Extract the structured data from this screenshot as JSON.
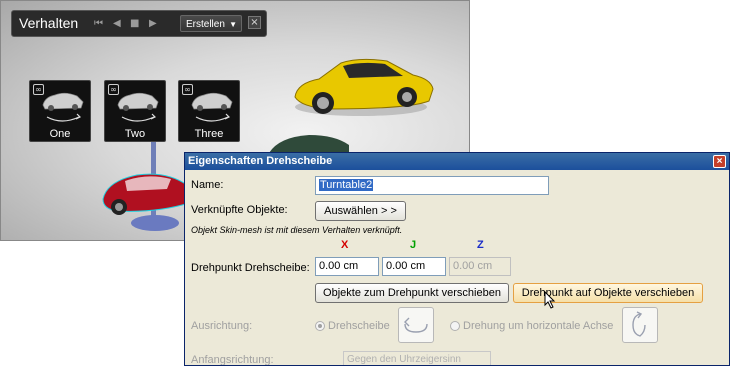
{
  "viewport": {
    "toolbar": {
      "title": "Verhalten",
      "create_button": "Erstellen",
      "close": "×"
    },
    "behaviors": [
      {
        "label": "One"
      },
      {
        "label": "Two"
      },
      {
        "label": "Three"
      }
    ]
  },
  "dialog": {
    "title": "Eigenschaften Drehscheibe",
    "close": "×",
    "name_label": "Name:",
    "name_value": "Turntable2",
    "linked_label": "Verknüpfte Objekte:",
    "select_button": "Auswählen > >",
    "note": "Objekt Skin-mesh ist mit diesem Verhalten verknüpft.",
    "axis_labels": {
      "x": "X",
      "y": "J",
      "z": "Z"
    },
    "pivot_label": "Drehpunkt Drehscheibe:",
    "pivot_x": "0.00 cm",
    "pivot_y": "0.00 cm",
    "pivot_z": "0.00 cm",
    "move_objects_button": "Objekte zum Drehpunkt verschieben",
    "move_pivot_button": "Drehpunkt auf Objekte verschieben",
    "orientation_label": "Ausrichtung:",
    "orientation_option_1": "Drehscheibe",
    "orientation_option_2": "Drehung um horizontale Achse",
    "start_direction_label": "Anfangsrichtung:",
    "start_direction_value": "Gegen den Uhrzeigersinn"
  },
  "colors": {
    "x_axis": "#d40000",
    "y_axis": "#00a000",
    "z_axis": "#1a2cc8",
    "title_bar": "#2a5ca6",
    "car_yellow": "#e8c800",
    "car_red": "#b01020"
  }
}
